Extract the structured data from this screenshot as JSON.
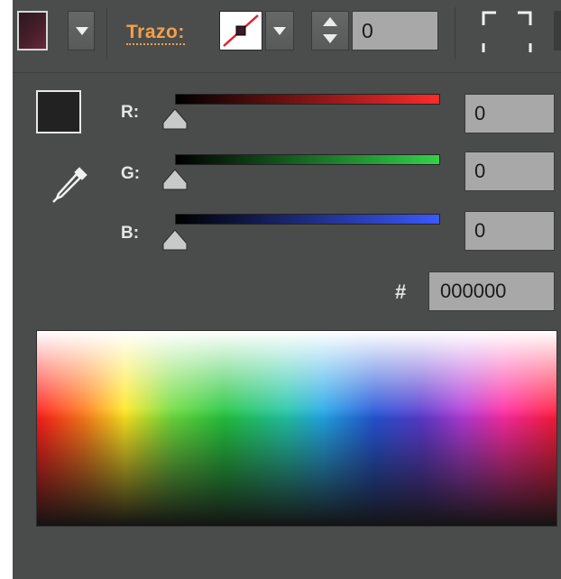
{
  "toolbar": {
    "stroke_label": "Trazo:",
    "stroke_width_value": "0"
  },
  "color_mode": {
    "channels": [
      {
        "label": "R:",
        "value": "0"
      },
      {
        "label": "G:",
        "value": "0"
      },
      {
        "label": "B:",
        "value": "0"
      }
    ],
    "hex_label": "#",
    "hex_value": "000000"
  },
  "icons": {
    "fill_swatch": "fill-color-swatch",
    "dropdown": "chevron-down-icon",
    "stroke_swatch": "stroke-none-swatch",
    "stepper": "stepper-icon",
    "align": "align-corners-icon",
    "eyedropper": "eyedropper-icon",
    "slider_thumb": "slider-thumb-icon"
  },
  "colors": {
    "panel_bg": "#4a4c4b",
    "stroke_label_accent": "#f4a04a",
    "input_bg": "#a8a8a8",
    "current_color": "#222222"
  }
}
